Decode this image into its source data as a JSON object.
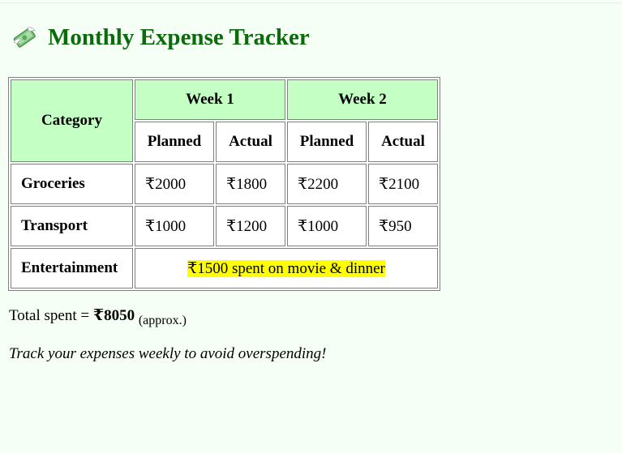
{
  "page": {
    "title": "Monthly Expense Tracker",
    "title_icon": "money-with-wings-icon",
    "accent_color": "#0a6b0a",
    "header_fill": "#c4ffc4",
    "highlight_color": "#ffff00"
  },
  "table": {
    "category_header": "Category",
    "weeks": [
      "Week 1",
      "Week 2"
    ],
    "subheaders": [
      "Planned",
      "Actual",
      "Planned",
      "Actual"
    ],
    "rows": [
      {
        "category": "Groceries",
        "values": [
          "₹2000",
          "₹1800",
          "₹2200",
          "₹2100"
        ]
      },
      {
        "category": "Transport",
        "values": [
          "₹1000",
          "₹1200",
          "₹1000",
          "₹950"
        ]
      }
    ],
    "entertainment": {
      "category": "Entertainment",
      "note": "₹1500 spent on movie & dinner"
    }
  },
  "summary": {
    "total_prefix": "Total spent = ",
    "total_value": "₹8050",
    "total_suffix": "(approx.)",
    "tip": "Track your expenses weekly to avoid overspending!"
  }
}
